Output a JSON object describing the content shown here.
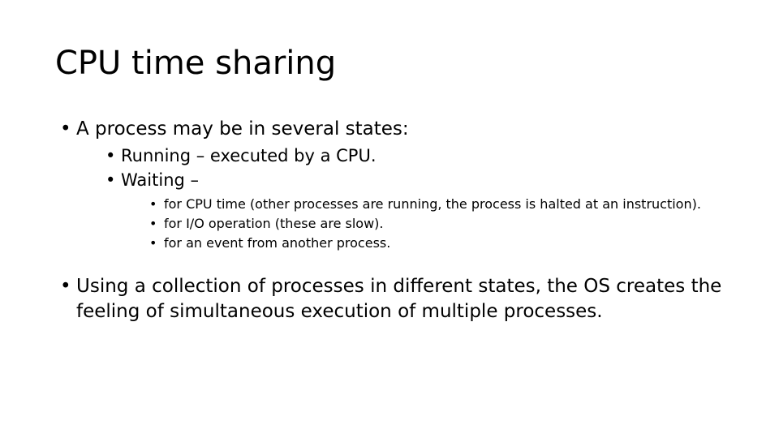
{
  "slide": {
    "title": "CPU time sharing",
    "background_color": "#FFFFFF",
    "text_color": "#000000",
    "bullet_glyph": "•",
    "content": {
      "bullet_1": {
        "text": "A process may be in several states:",
        "children": {
          "bullet_1_1": {
            "text": "Running – executed by a CPU."
          },
          "bullet_1_2": {
            "text": "Waiting –",
            "children": {
              "bullet_1_2_1": {
                "text": "for CPU time (other processes are running, the process is halted at an instruction)."
              },
              "bullet_1_2_2": {
                "text": "for I/O operation (these are slow)."
              },
              "bullet_1_2_3": {
                "text": "for an event from another process."
              }
            }
          }
        }
      },
      "bullet_2": {
        "text": "Using a collection of processes in different states, the OS creates the feeling of simultaneous execution of multiple processes."
      }
    }
  }
}
